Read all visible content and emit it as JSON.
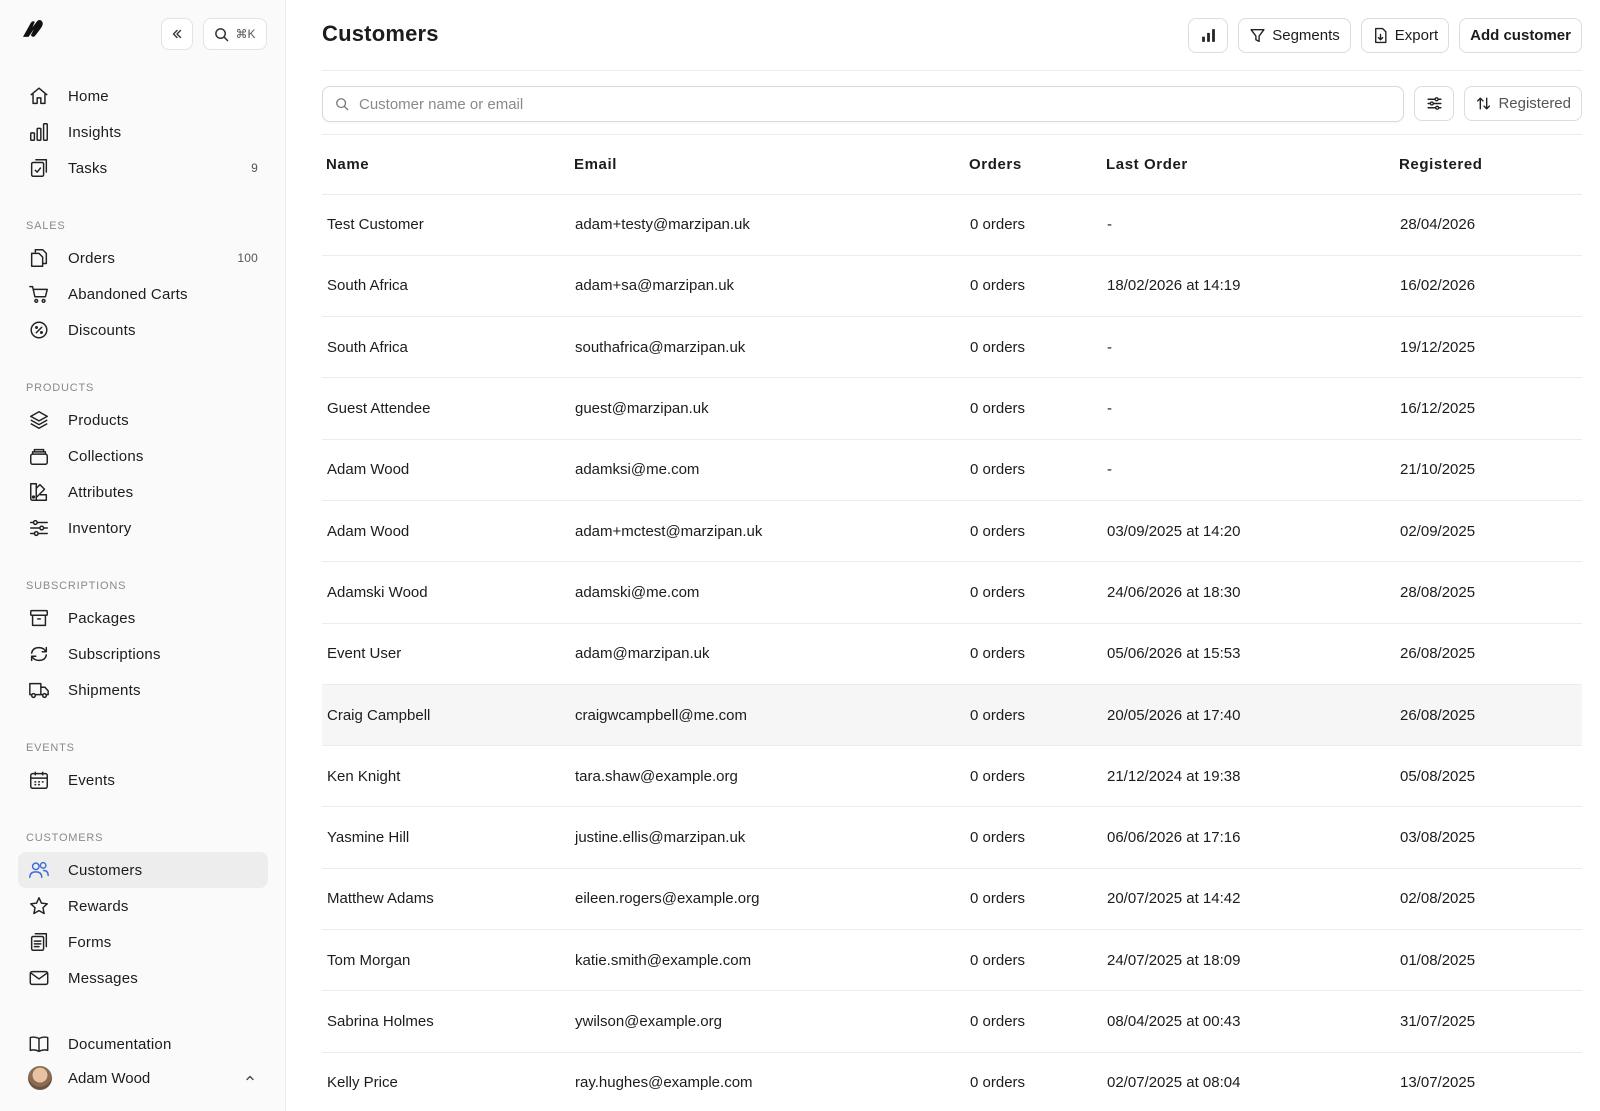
{
  "colors": {
    "accent": "#3b6fd8",
    "active_bg": "#ededed"
  },
  "sidebar": {
    "search_shortcut": "⌘K",
    "primary": [
      {
        "label": "Home",
        "icon": "home-icon"
      },
      {
        "label": "Insights",
        "icon": "bar-chart-icon"
      },
      {
        "label": "Tasks",
        "icon": "clipboard-check-icon",
        "count": "9"
      }
    ],
    "sections": {
      "sales": {
        "label": "SALES",
        "items": [
          {
            "label": "Orders",
            "icon": "documents-icon",
            "count": "100"
          },
          {
            "label": "Abandoned Carts",
            "icon": "cart-icon"
          },
          {
            "label": "Discounts",
            "icon": "discount-badge-icon"
          }
        ]
      },
      "products": {
        "label": "PRODUCTS",
        "items": [
          {
            "label": "Products",
            "icon": "layers-icon"
          },
          {
            "label": "Collections",
            "icon": "stack-icon"
          },
          {
            "label": "Attributes",
            "icon": "swatch-icon"
          },
          {
            "label": "Inventory",
            "icon": "sliders-icon"
          }
        ]
      },
      "subscriptions": {
        "label": "SUBSCRIPTIONS",
        "items": [
          {
            "label": "Packages",
            "icon": "archive-box-icon"
          },
          {
            "label": "Subscriptions",
            "icon": "refresh-icon"
          },
          {
            "label": "Shipments",
            "icon": "truck-icon"
          }
        ]
      },
      "events": {
        "label": "EVENTS",
        "items": [
          {
            "label": "Events",
            "icon": "calendar-icon"
          }
        ]
      },
      "customers": {
        "label": "CUSTOMERS",
        "items": [
          {
            "label": "Customers",
            "icon": "users-icon",
            "active": true
          },
          {
            "label": "Rewards",
            "icon": "star-icon"
          },
          {
            "label": "Forms",
            "icon": "form-clipboard-icon"
          },
          {
            "label": "Messages",
            "icon": "envelope-icon"
          }
        ]
      }
    },
    "documentation": "Documentation",
    "user_name": "Adam Wood"
  },
  "main": {
    "title": "Customers",
    "actions": {
      "segments": "Segments",
      "export": "Export",
      "add": "Add customer"
    },
    "search_placeholder": "Customer name or email",
    "sort_label": "Registered",
    "table": {
      "headers": [
        "Name",
        "Email",
        "Orders",
        "Last Order",
        "Registered"
      ],
      "rows": [
        [
          "Test Customer",
          "adam+testy@marzipan.uk",
          "0 orders",
          "-",
          "28/04/2026"
        ],
        [
          "South Africa",
          "adam+sa@marzipan.uk",
          "0 orders",
          "18/02/2026 at 14:19",
          "16/02/2026"
        ],
        [
          "South Africa",
          "southafrica@marzipan.uk",
          "0 orders",
          "-",
          "19/12/2025"
        ],
        [
          "Guest Attendee",
          "guest@marzipan.uk",
          "0 orders",
          "-",
          "16/12/2025"
        ],
        [
          "Adam Wood",
          "adamksi@me.com",
          "0 orders",
          "-",
          "21/10/2025"
        ],
        [
          "Adam Wood",
          "adam+mctest@marzipan.uk",
          "0 orders",
          "03/09/2025 at 14:20",
          "02/09/2025"
        ],
        [
          "Adamski Wood",
          "adamski@me.com",
          "0 orders",
          "24/06/2026 at 18:30",
          "28/08/2025"
        ],
        [
          "Event User",
          "adam@marzipan.uk",
          "0 orders",
          "05/06/2026 at 15:53",
          "26/08/2025"
        ],
        [
          "Craig Campbell",
          "craigwcampbell@me.com",
          "0 orders",
          "20/05/2026 at 17:40",
          "26/08/2025"
        ],
        [
          "Ken Knight",
          "tara.shaw@example.org",
          "0 orders",
          "21/12/2024 at 19:38",
          "05/08/2025"
        ],
        [
          "Yasmine Hill",
          "justine.ellis@marzipan.uk",
          "0 orders",
          "06/06/2026 at 17:16",
          "03/08/2025"
        ],
        [
          "Matthew Adams",
          "eileen.rogers@example.org",
          "0 orders",
          "20/07/2025 at 14:42",
          "02/08/2025"
        ],
        [
          "Tom Morgan",
          "katie.smith@example.com",
          "0 orders",
          "24/07/2025 at 18:09",
          "01/08/2025"
        ],
        [
          "Sabrina Holmes",
          "ywilson@example.org",
          "0 orders",
          "08/04/2025 at 00:43",
          "31/07/2025"
        ],
        [
          "Kelly Price",
          "ray.hughes@example.com",
          "0 orders",
          "02/07/2025 at 08:04",
          "13/07/2025"
        ]
      ],
      "hover_row": 8
    }
  }
}
